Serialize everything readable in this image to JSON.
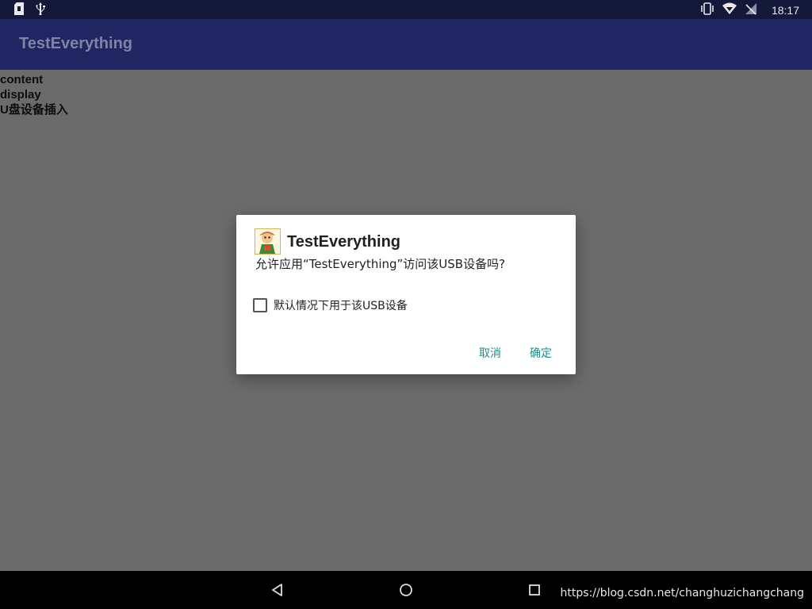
{
  "status_bar": {
    "time": "18:17",
    "left_icons": [
      "sim-card-icon",
      "usb-icon"
    ],
    "right_icons": [
      "vibrate-icon",
      "wifi-icon",
      "no-signal-icon"
    ]
  },
  "app_bar": {
    "title": "TestEverything"
  },
  "content": {
    "lines": [
      "content",
      "display",
      "U盘设备插入"
    ]
  },
  "dialog": {
    "title": "TestEverything",
    "message": "允许应用“TestEverything”访问该USB设备吗?",
    "checkbox_label": "默认情况下用于该USB设备",
    "checkbox_checked": false,
    "cancel_label": "取消",
    "ok_label": "确定",
    "accent_color": "#1a8f8a"
  },
  "nav_bar": {
    "buttons": [
      "back-icon",
      "home-icon",
      "recents-icon"
    ]
  },
  "watermark": "https://blog.csdn.net/changhuzichangchang"
}
